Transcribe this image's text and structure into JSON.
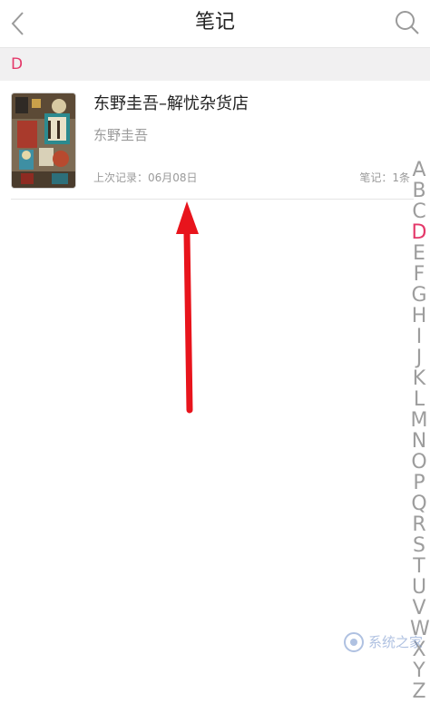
{
  "header": {
    "title": "笔记",
    "back_icon": "chevron-left-icon",
    "search_icon": "search-icon"
  },
  "section": {
    "letter": "D"
  },
  "note": {
    "title": "东野圭吾–解忧杂货店",
    "author": "东野圭吾",
    "last_record": "上次记录：06月08日",
    "note_count": "笔记：1条"
  },
  "index_bar": {
    "letters": [
      "A",
      "B",
      "C",
      "D",
      "E",
      "F",
      "G",
      "H",
      "I",
      "J",
      "K",
      "L",
      "M",
      "N",
      "O",
      "P",
      "Q",
      "R",
      "S",
      "T",
      "U",
      "V",
      "W",
      "X",
      "Y",
      "Z"
    ],
    "active": "D"
  },
  "watermark": {
    "text": "系统之家"
  },
  "colors": {
    "accent": "#e4396a",
    "arrow": "#e8141c",
    "section_bg": "#f1f0f1"
  }
}
